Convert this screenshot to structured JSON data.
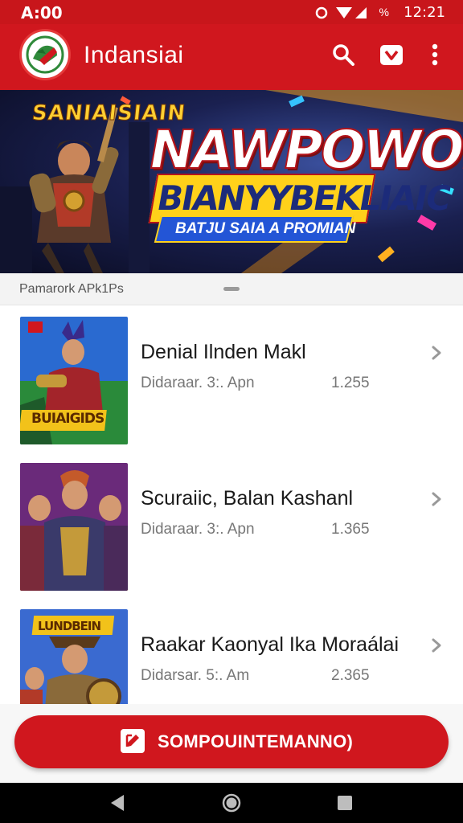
{
  "status_bar": {
    "time_left": "A:00",
    "percent": "%",
    "time_right": "12:21"
  },
  "app_bar": {
    "title": "Indansiai",
    "logo_icon": "app-logo",
    "search_icon": "search-icon",
    "store_icon": "store-icon",
    "menu_icon": "more-vert-icon"
  },
  "banner": {
    "badge": "SANIAISIAIN",
    "title": "NAWPOWON",
    "subtitle": "BIANYYBEKLIAIC",
    "tag": "BATJU SAIA A PROMIAN"
  },
  "section": {
    "title": "Pamarork APk1Ps"
  },
  "list": {
    "items": [
      {
        "title": "Denial Ilnden Makl",
        "subtitle": "Didaraar. 3:. Apn",
        "count": "1.255",
        "thumb_caption": "BUIAIGIDS"
      },
      {
        "title": "Scuraiic, Balan Kashanl",
        "subtitle": "Didaraar. 3:. Apn",
        "count": "1.365",
        "thumb_caption": ""
      },
      {
        "title": "Raakar Kaonyal Ika Moraálai",
        "subtitle": "Didarsar. 5:. Am",
        "count": "2.365",
        "thumb_caption": "LUNDBEIN"
      }
    ]
  },
  "bottom_button": {
    "label": "SOMPOUINTEMANNO)"
  },
  "colors": {
    "brand_red": "#d0171e",
    "status_red": "#c8161b"
  }
}
